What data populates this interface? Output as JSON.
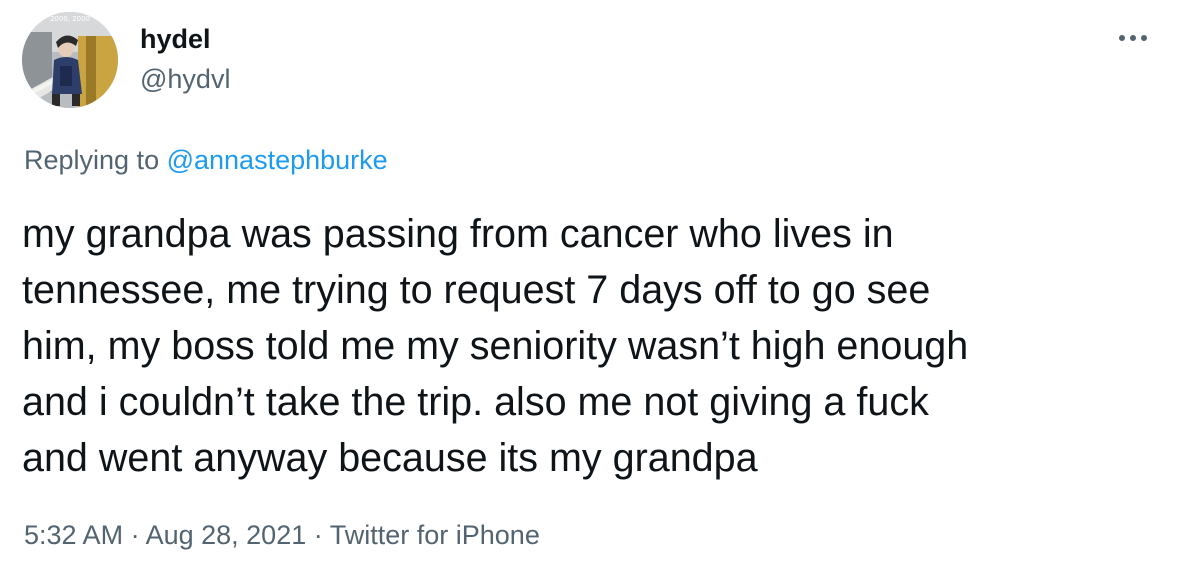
{
  "user": {
    "display_name": "hydel",
    "handle": "@hydvl",
    "avatar_caption": "2000, 2000"
  },
  "reply": {
    "prefix": "Replying to ",
    "mention": "@annastephburke"
  },
  "tweet": {
    "lines": [
      "my grandpa was passing from cancer who lives in",
      "tennessee, me trying to request 7 days off to go see",
      "him, my boss told me my seniority wasn’t high enough",
      "and i couldn’t take the trip. also me not giving a fuck",
      "and went anyway because its my grandpa"
    ]
  },
  "meta": {
    "time": "5:32 AM",
    "sep1": " · ",
    "date": "Aug 28, 2021",
    "sep2": " · ",
    "source": "Twitter for iPhone"
  },
  "icons": {
    "more": "more-horizontal-icon"
  },
  "colors": {
    "text": "#0f1419",
    "secondary": "#536471",
    "link": "#1d9bf0"
  }
}
